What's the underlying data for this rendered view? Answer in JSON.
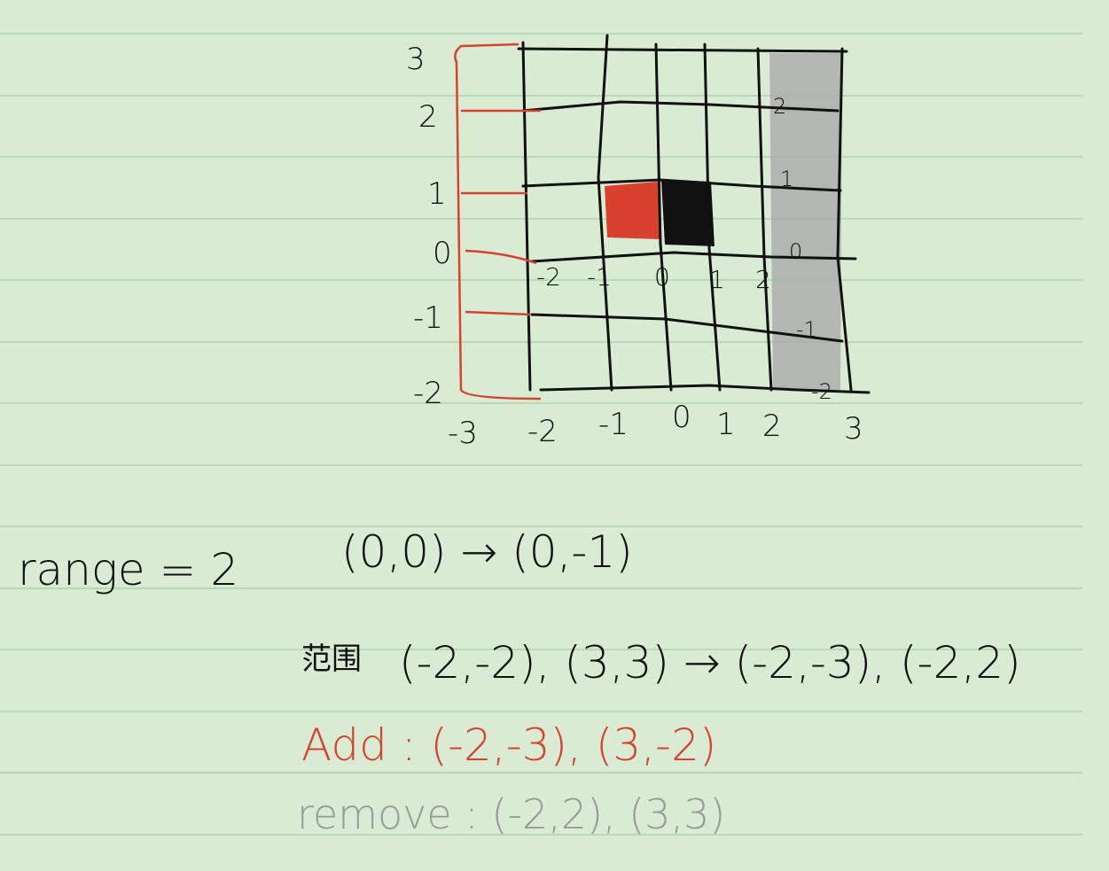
{
  "diagram": {
    "y_axis_labels": [
      "3",
      "2",
      "1",
      "0",
      "-1",
      "-2"
    ],
    "x_axis_labels": [
      "-3",
      "-2",
      "-1",
      "0",
      "1",
      "2",
      "3"
    ],
    "inner_row_labels": [
      "-2",
      "-1",
      "0",
      "1",
      "2"
    ],
    "right_column_labels": [
      "2",
      "1",
      "0",
      "-1",
      "-2"
    ],
    "colors": {
      "paper": "#d9ecd3",
      "rule": "#9fd0a4",
      "ink": "#111111",
      "added": "#d9412f",
      "removed": "#999999"
    }
  },
  "notes": {
    "range": "range = 2",
    "move": "(0,0) → (0,-1)",
    "range_label": "范围",
    "range_change": "(-2,-2), (3,3) → (-2,-3), (-2,2)",
    "add": "Add : (-2,-3), (3,-2)",
    "remove": "remove : (-2,2), (3,3)"
  }
}
